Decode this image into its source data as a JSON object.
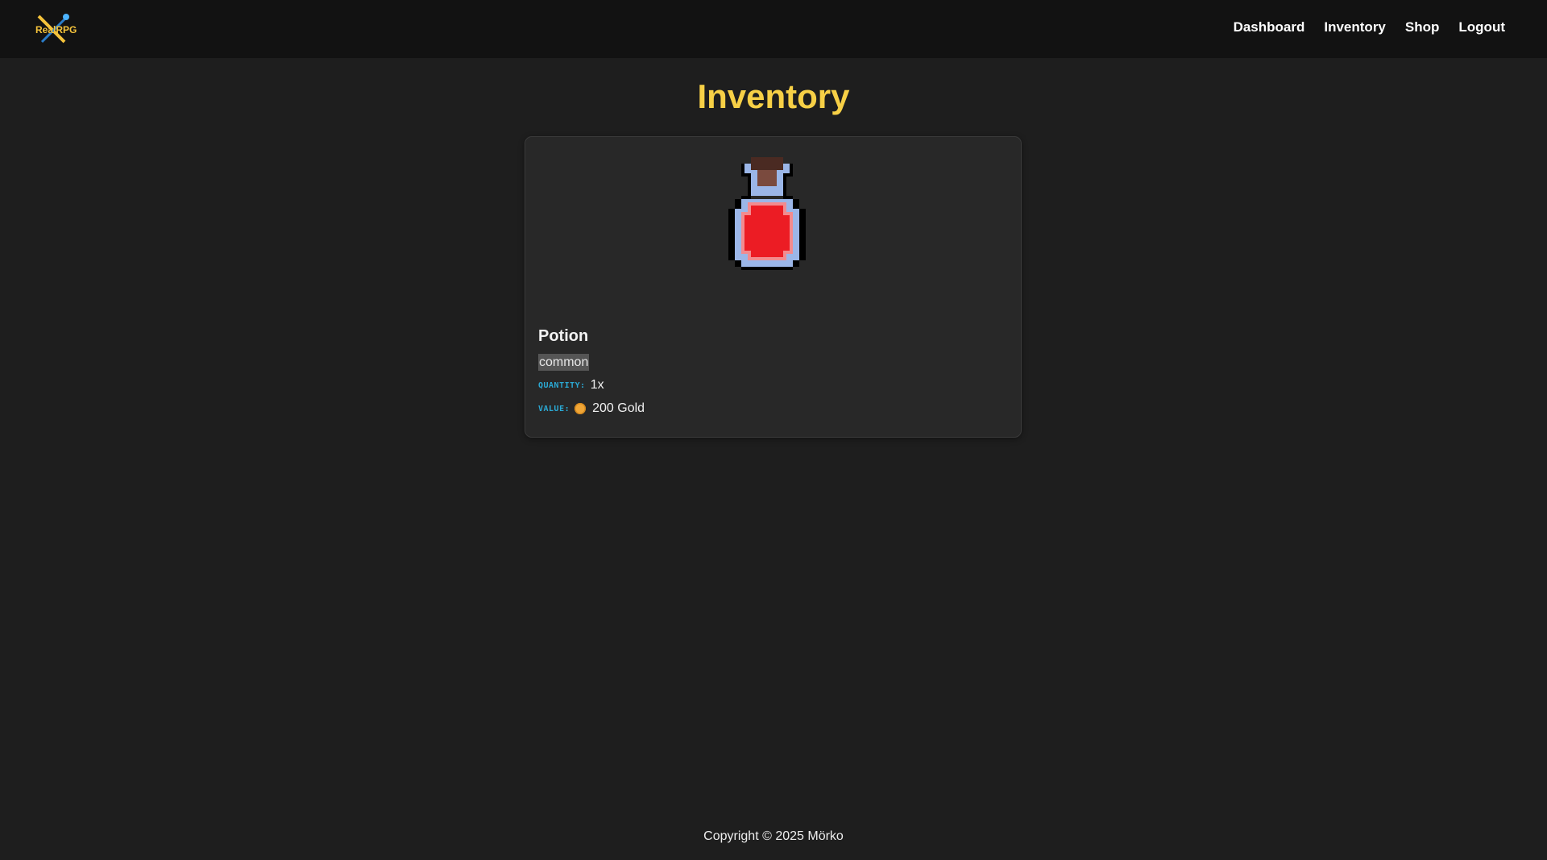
{
  "header": {
    "logo_text": "RealRPG",
    "nav": {
      "dashboard": "Dashboard",
      "inventory": "Inventory",
      "shop": "Shop",
      "logout": "Logout"
    }
  },
  "main": {
    "title": "Inventory",
    "items": [
      {
        "name": "Potion",
        "icon": "red-potion-icon",
        "rarity": "common",
        "quantity_label": "QUANTITY:",
        "quantity": "1x",
        "value_label": "VALUE:",
        "value_icon": "gold-coin-icon",
        "value": "200 Gold"
      }
    ]
  },
  "footer": {
    "copyright": "Copyright © 2025 Mörko"
  },
  "colors": {
    "accent": "#f7d046",
    "label": "#2ba9d4",
    "potion": "#ec1c24",
    "bottle": "#9bb6e8"
  }
}
